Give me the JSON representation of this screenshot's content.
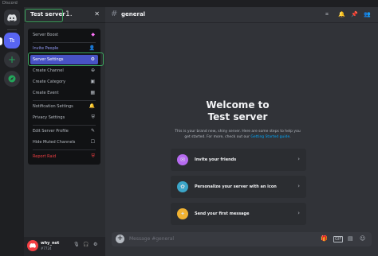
{
  "window": {
    "title": "Discord"
  },
  "rail": {
    "server_initials": "Ts",
    "add_icon": "plus-icon",
    "explore_icon": "compass-icon"
  },
  "sidebar": {
    "server_name": "Test server",
    "close_icon": "close-icon"
  },
  "annotations": {
    "step1": "1.",
    "step2": "2."
  },
  "menu": {
    "items": [
      {
        "label": "Server Boost",
        "icon": "boost-icon"
      },
      {
        "label": "Invite People",
        "icon": "add-person-icon"
      },
      {
        "label": "Server Settings",
        "icon": "gear-icon"
      },
      {
        "label": "Create Channel",
        "icon": "add-circle-icon"
      },
      {
        "label": "Create Category",
        "icon": "folder-plus-icon"
      },
      {
        "label": "Create Event",
        "icon": "calendar-plus-icon"
      },
      {
        "label": "Notification Settings",
        "icon": "bell-icon"
      },
      {
        "label": "Privacy Settings",
        "icon": "shield-icon"
      },
      {
        "label": "Edit Server Profile",
        "icon": "pencil-icon"
      },
      {
        "label": "Hide Muted Channels",
        "icon": "checkbox-icon"
      },
      {
        "label": "Report Raid",
        "icon": "shield-alert-icon"
      }
    ]
  },
  "user": {
    "name": "why_not",
    "tag": "#7724"
  },
  "header": {
    "channel": "general"
  },
  "welcome": {
    "title_line1": "Welcome to",
    "title_line2": "Test server",
    "sub_line1": "This is your brand new, shiny server. Here are some steps to help you",
    "sub_line2_pre": "get started. For more, check out our ",
    "sub_link": "Getting Started guide",
    "sub_line2_post": "."
  },
  "cards": [
    {
      "label": "Invite your friends",
      "icon": "invite-friends-icon",
      "color": "#b66bf0"
    },
    {
      "label": "Personalize your server with an icon",
      "icon": "palette-icon",
      "color": "#3ba5c8"
    },
    {
      "label": "Send your first message",
      "icon": "message-icon",
      "color": "#f0b232"
    }
  ],
  "composer": {
    "placeholder": "Message #general"
  },
  "colors": {
    "accent": "#5865f2",
    "highlight": "#3ba55c",
    "danger": "#f23f43",
    "boost": "#ff73fa"
  }
}
